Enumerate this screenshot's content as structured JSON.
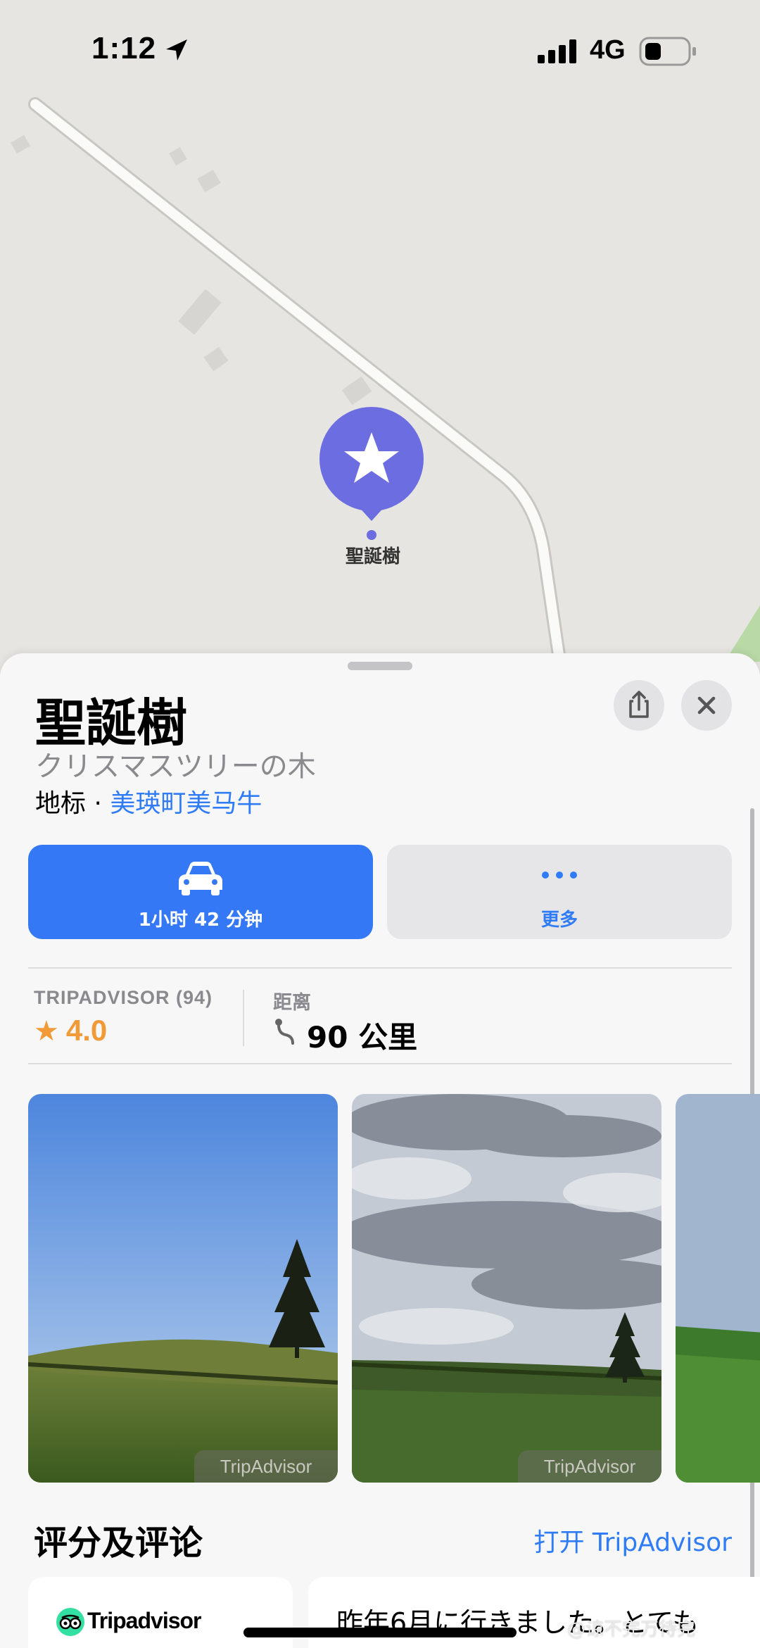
{
  "status_bar": {
    "time": "1:12",
    "network": "4G"
  },
  "map": {
    "pin_label": "聖誕樹",
    "pin_color": "#6b6de0"
  },
  "place": {
    "title": "聖誕樹",
    "subtitle": "クリスマスツリーの木",
    "category": "地标",
    "separator": " · ",
    "locality": "美瑛町美马牛"
  },
  "actions": {
    "drive_label": "1小时 42 分钟",
    "more_label": "更多"
  },
  "stats": {
    "rating_source": "TRIPADVISOR (94)",
    "rating_value": "4.0",
    "distance_label": "距离",
    "distance_value": "90 公里"
  },
  "photos": [
    {
      "credit": "TripAdvisor"
    },
    {
      "credit": "TripAdvisor"
    }
  ],
  "reviews": {
    "title": "评分及评论",
    "open_link": "打开 TripAdvisor",
    "provider": "Tripadvisor",
    "first_review_text": "昨年6月に行きました。とても"
  },
  "watermark": "@谅不完万待完",
  "colors": {
    "accent": "#3478f6",
    "link": "#2f7cf6",
    "rating": "#f19a38"
  }
}
